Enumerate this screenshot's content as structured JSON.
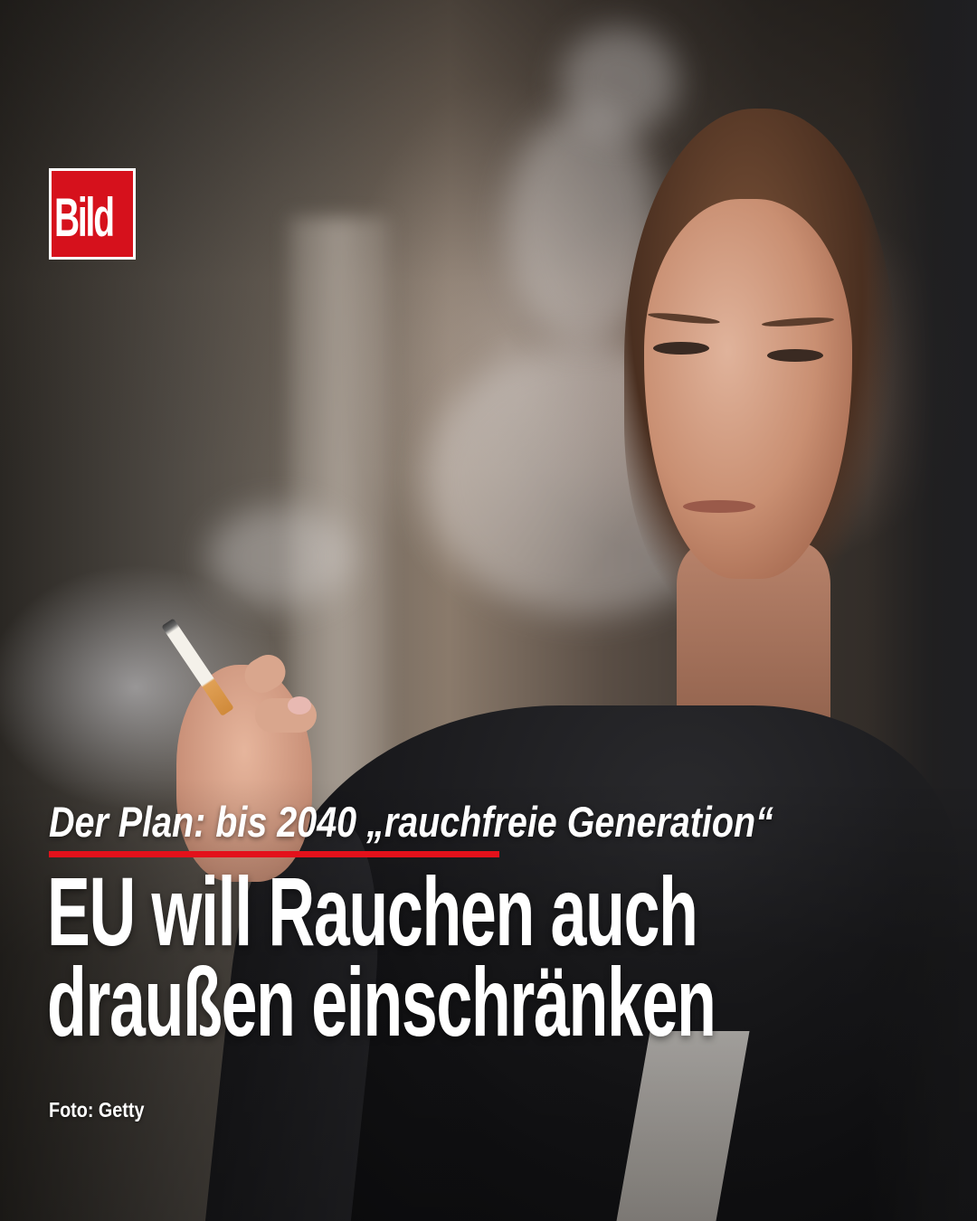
{
  "brand": {
    "logo_text": "Bild",
    "logo_color": "#d6111c"
  },
  "post": {
    "kicker": "Der Plan: bis 2040 „rauchfreie Generation“",
    "headline_lines": [
      "EU will Rauchen auch",
      "draußen einschränken"
    ],
    "photo_credit": "Foto: Getty"
  },
  "colors": {
    "accent_rule": "#e3111b",
    "text": "#ffffff"
  }
}
